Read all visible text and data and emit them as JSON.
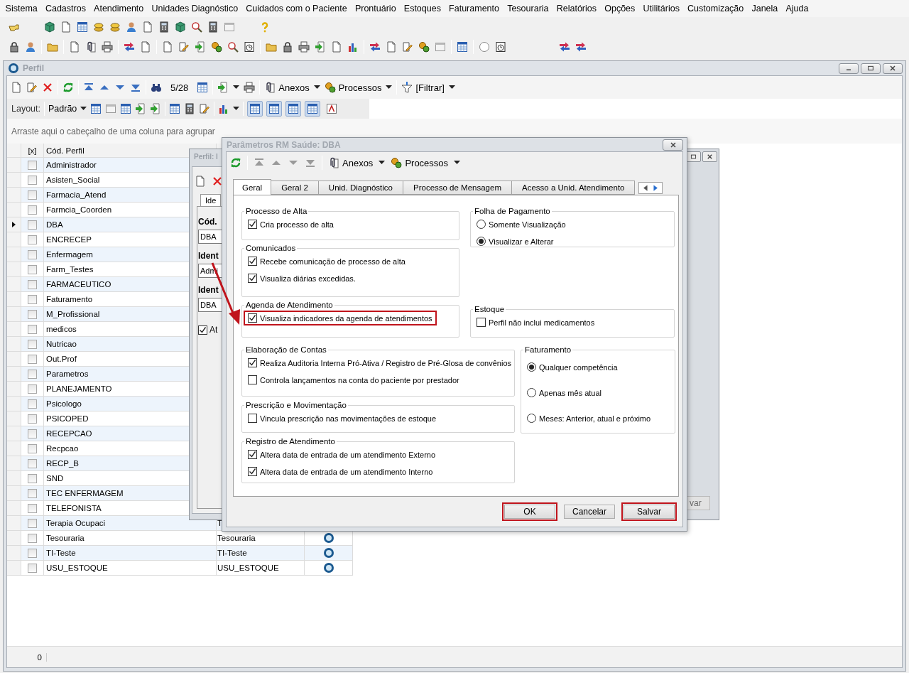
{
  "menu": [
    "Sistema",
    "Cadastros",
    "Atendimento",
    "Unidades Diagnóstico",
    "Cuidados com o Paciente",
    "Prontuário",
    "Estoques",
    "Faturamento",
    "Tesouraria",
    "Relatórios",
    "Opções",
    "Utilitários",
    "Customização",
    "Janela",
    "Ajuda"
  ],
  "window": {
    "title": "Perfil",
    "counter": "5/28",
    "anexos": "Anexos",
    "processos": "Processos",
    "filter": "[Filtrar]",
    "layout_label": "Layout:",
    "layout_preset": "Padrão",
    "layout_toggles": [
      {
        "selected": true
      },
      {
        "selected": true
      },
      {
        "selected": true
      },
      {
        "selected": true
      },
      {
        "selected": false
      }
    ],
    "group_hint": "Arraste aqui o cabeçalho de uma coluna para agrupar",
    "footer": "0"
  },
  "grid": {
    "columns": [
      "[x]",
      "Cód. Perfil"
    ],
    "rows": [
      {
        "code": "Administrador",
        "checked": false,
        "selected": false
      },
      {
        "code": "Asisten_Social",
        "checked": false,
        "selected": false
      },
      {
        "code": "Farmacia_Atend",
        "checked": false,
        "selected": false
      },
      {
        "code": "Farmcia_Coorden",
        "checked": false,
        "selected": false
      },
      {
        "code": "DBA",
        "checked": false,
        "selected": true
      },
      {
        "code": "ENCRECEP",
        "checked": false,
        "selected": false
      },
      {
        "code": "Enfermagem",
        "checked": false,
        "selected": false
      },
      {
        "code": "Farm_Testes",
        "checked": false,
        "selected": false
      },
      {
        "code": "FARMACEUTICO",
        "checked": false,
        "selected": false
      },
      {
        "code": "Faturamento",
        "checked": false,
        "selected": false
      },
      {
        "code": "M_Profissional",
        "checked": false,
        "selected": false
      },
      {
        "code": "medicos",
        "checked": false,
        "selected": false
      },
      {
        "code": "Nutricao",
        "checked": false,
        "selected": false
      },
      {
        "code": "Out.Prof",
        "checked": false,
        "selected": false
      },
      {
        "code": "Parametros",
        "checked": false,
        "selected": false
      },
      {
        "code": "PLANEJAMENTO",
        "checked": false,
        "selected": false
      },
      {
        "code": "Psicologo",
        "checked": false,
        "selected": false
      },
      {
        "code": "PSICOPED",
        "checked": false,
        "selected": false
      },
      {
        "code": "RECEPCAO",
        "checked": false,
        "selected": false
      },
      {
        "code": "Recpcao",
        "checked": false,
        "selected": false
      },
      {
        "code": "RECP_B",
        "checked": false,
        "selected": false
      },
      {
        "code": "SND",
        "checked": false,
        "selected": false
      },
      {
        "code": "TEC ENFERMAGEM",
        "checked": false,
        "selected": false
      },
      {
        "code": "TELEFONISTA",
        "checked": false,
        "selected": false
      },
      {
        "code": "Terapia Ocupaci",
        "description": "T",
        "checked": false,
        "selected": false
      },
      {
        "code": "Tesouraria",
        "description": "Tesouraria",
        "checked": false,
        "selected": false,
        "icon": true
      },
      {
        "code": "TI-Teste",
        "description": "TI-Teste",
        "checked": false,
        "selected": false,
        "icon": true
      },
      {
        "code": "USU_ESTOQUE",
        "description": "USU_ESTOQUE",
        "checked": false,
        "selected": false,
        "icon": true
      }
    ]
  },
  "back_dialog": {
    "title": "Perfil: I",
    "tab": "Ide",
    "fields": [
      {
        "label": "Cód.",
        "value": "DBA"
      },
      {
        "label": "Ident",
        "value": "Admi"
      },
      {
        "label": "Ident",
        "value": "DBA"
      }
    ],
    "checkbox": {
      "label": "At",
      "checked": true
    },
    "button": "var"
  },
  "dialog": {
    "title": "Parâmetros RM Saúde: DBA",
    "anexos": "Anexos",
    "processos": "Processos",
    "tabs": [
      {
        "label": "Geral",
        "selected": true
      },
      {
        "label": "Geral 2",
        "selected": false
      },
      {
        "label": "Unid. Diagnóstico",
        "selected": false
      },
      {
        "label": "Processo de Mensagem",
        "selected": false
      },
      {
        "label": "Acesso a Unid. Atendimento",
        "selected": false
      }
    ],
    "groups": [
      {
        "title": "Processo de Alta",
        "items": [
          {
            "kind": "checkbox",
            "label": "Cria processo de alta",
            "checked": true,
            "highlighted": false
          }
        ]
      },
      {
        "title": "Comunicados",
        "items": [
          {
            "kind": "checkbox",
            "label": "Recebe comunicação de processo de alta",
            "checked": true,
            "highlighted": false
          },
          {
            "kind": "checkbox",
            "label": "Visualiza diárias excedidas.",
            "checked": true,
            "highlighted": false
          }
        ]
      },
      {
        "title": "Agenda de Atendimento",
        "items": [
          {
            "kind": "checkbox",
            "label": "Visualiza indicadores da agenda de atendimentos",
            "checked": true,
            "highlighted": true
          }
        ]
      },
      {
        "title": "Folha de Pagamento",
        "items": [
          {
            "kind": "radio",
            "label": "Somente Visualização",
            "selected": false,
            "highlighted": false
          },
          {
            "kind": "radio",
            "label": "Visualizar e Alterar",
            "selected": true,
            "highlighted": false
          }
        ]
      },
      {
        "title": "Estoque",
        "items": [
          {
            "kind": "checkbox",
            "label": "Perfil não inclui medicamentos",
            "checked": false,
            "highlighted": false
          }
        ]
      },
      {
        "title": "Elaboração de Contas",
        "items": [
          {
            "kind": "checkbox",
            "label": "Realiza Auditoria Interna Pró-Ativa / Registro de Pré-Glosa de convênios",
            "checked": true,
            "highlighted": false
          },
          {
            "kind": "checkbox",
            "label": "Controla lançamentos na conta do paciente por prestador",
            "checked": false,
            "highlighted": false
          }
        ]
      },
      {
        "title": "Prescrição e Movimentação",
        "items": [
          {
            "kind": "checkbox",
            "label": "Vincula prescrição nas movimentações de estoque",
            "checked": false,
            "highlighted": false
          }
        ]
      },
      {
        "title": "Registro de Atendimento",
        "items": [
          {
            "kind": "checkbox",
            "label": "Altera data de entrada de um atendimento Externo",
            "checked": true,
            "highlighted": false
          },
          {
            "kind": "checkbox",
            "label": "Altera data de entrada de um atendimento Interno",
            "checked": true,
            "highlighted": false
          }
        ]
      },
      {
        "title": "Faturamento",
        "items": [
          {
            "kind": "radio",
            "label": "Qualquer competência",
            "selected": true,
            "highlighted": false
          },
          {
            "kind": "radio",
            "label": "Apenas mês atual",
            "selected": false,
            "highlighted": false
          },
          {
            "kind": "radio",
            "label": "Meses: Anterior, atual e próximo",
            "selected": false,
            "highlighted": false
          }
        ]
      }
    ],
    "buttons": [
      {
        "label": "OK",
        "highlighted": true
      },
      {
        "label": "Cancelar",
        "highlighted": false
      },
      {
        "label": "Salvar",
        "highlighted": true
      }
    ]
  }
}
